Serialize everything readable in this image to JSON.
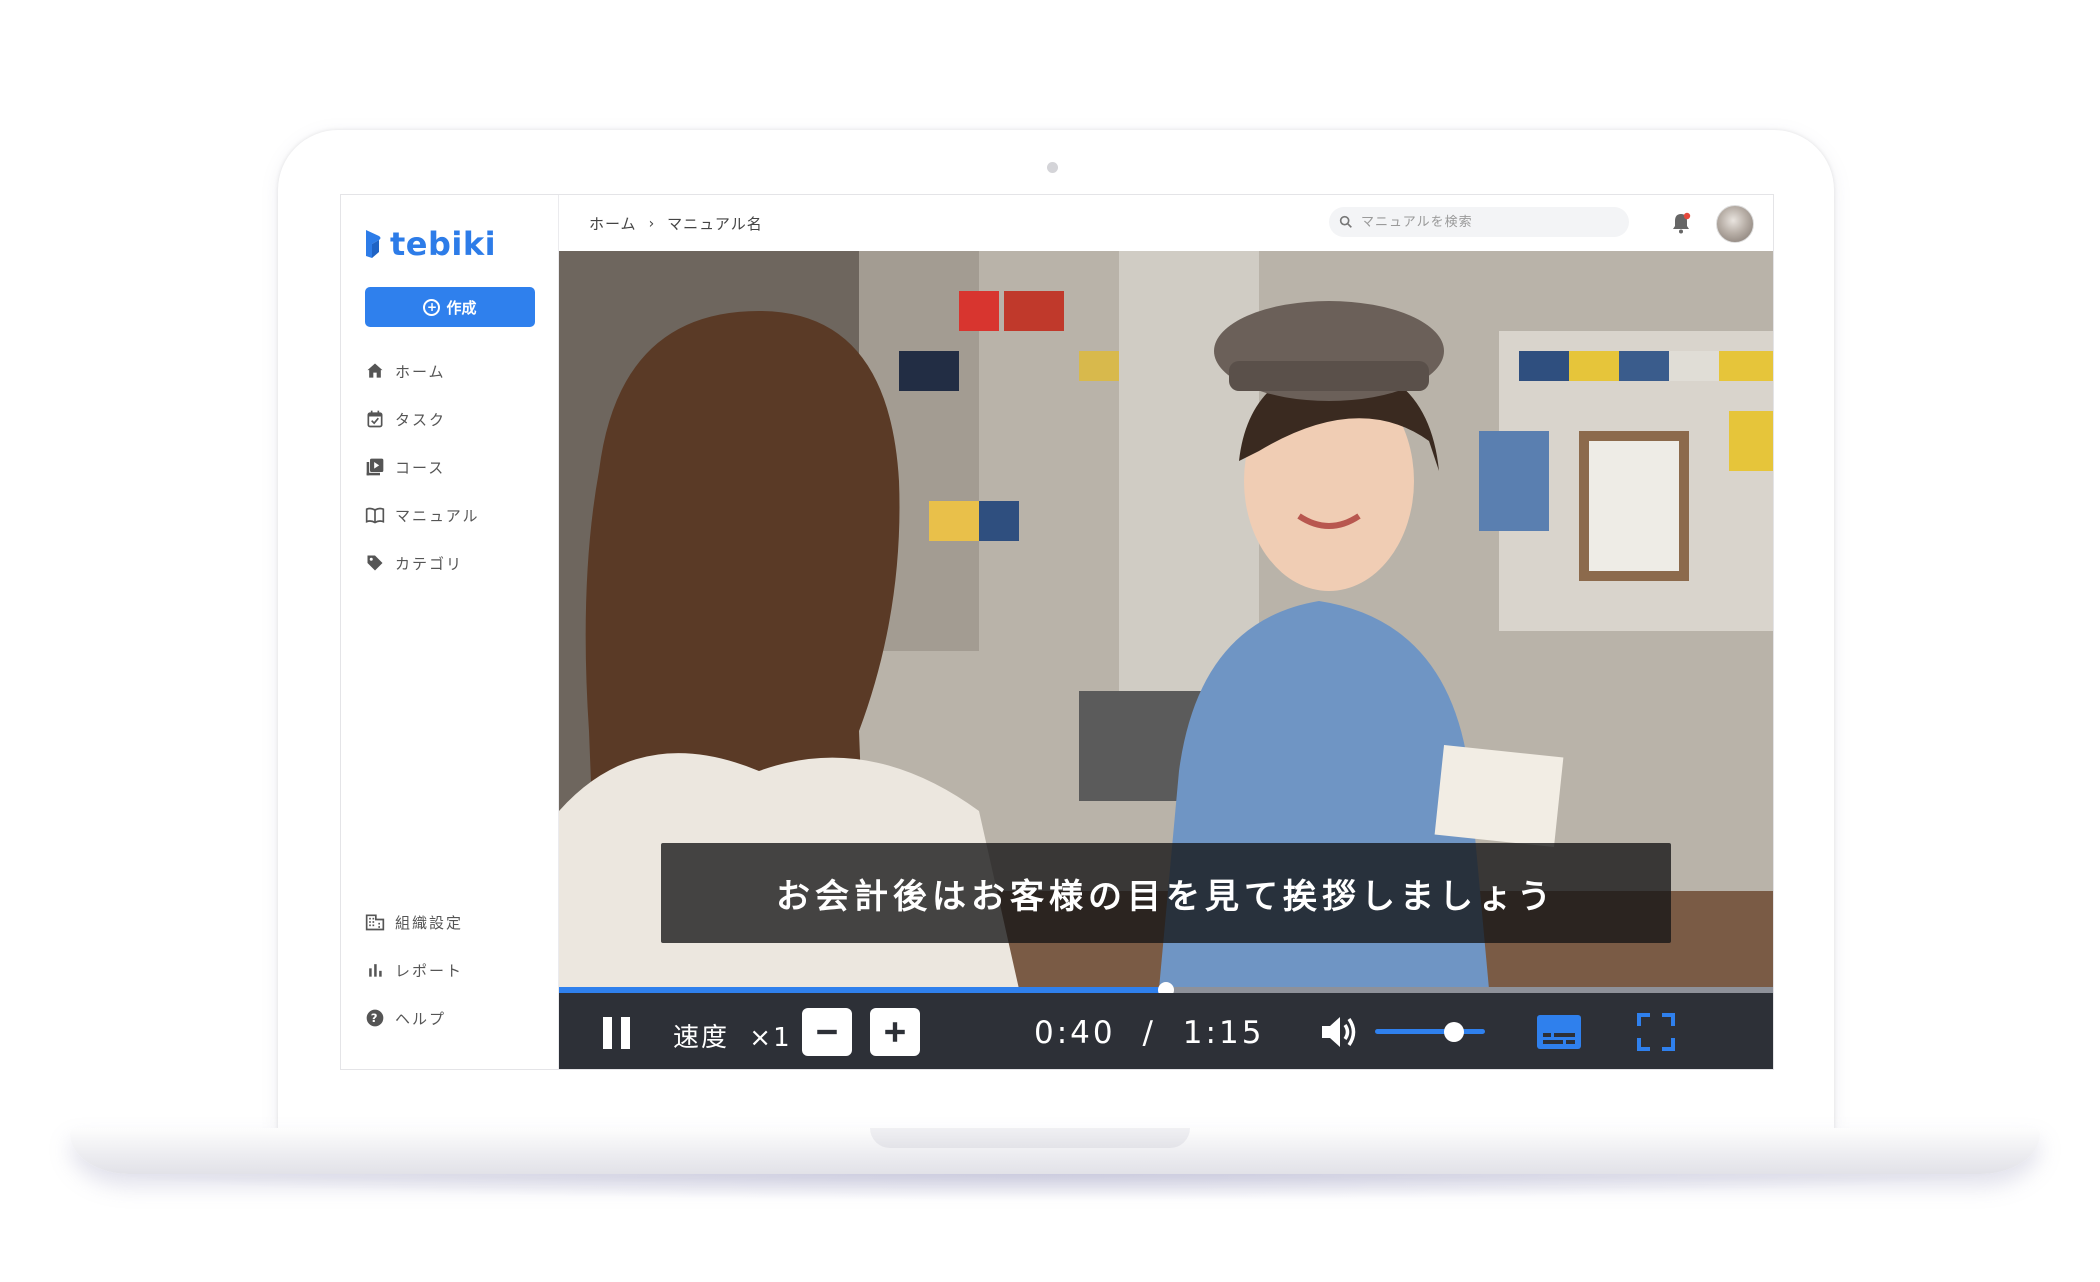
{
  "app": {
    "logo_text": "tebiki",
    "brand_color": "#2f80ed",
    "create_label": "作成"
  },
  "sidebar": {
    "items": [
      {
        "label": "ホーム",
        "icon": "home-icon"
      },
      {
        "label": "タスク",
        "icon": "task-icon"
      },
      {
        "label": "コース",
        "icon": "course-icon"
      },
      {
        "label": "マニュアル",
        "icon": "manual-book-icon"
      },
      {
        "label": "カテゴリ",
        "icon": "tag-icon"
      }
    ],
    "bottom_items": [
      {
        "label": "組織設定",
        "icon": "building-icon"
      },
      {
        "label": "レポート",
        "icon": "bar-chart-icon"
      },
      {
        "label": "ヘルプ",
        "icon": "help-icon"
      }
    ]
  },
  "header": {
    "breadcrumb": [
      "ホーム",
      "マニュアル名"
    ],
    "search_placeholder": "マニュアルを検索",
    "notification_dot_color": "#e5483c"
  },
  "player": {
    "subtitle": "お会計後はお客様の目を見て挨拶しましょう",
    "progress_fraction": 0.5,
    "speed_label": "速度",
    "speed_value": "×1",
    "current_time": "0:40",
    "time_separator": "/",
    "duration": "1:15",
    "volume_fraction": 0.72,
    "captions_on": true
  }
}
